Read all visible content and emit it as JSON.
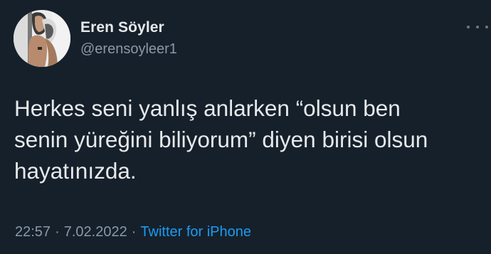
{
  "tweet": {
    "author": {
      "display_name": "Eren Söyler",
      "handle": "@erensoyleer1",
      "avatar": "profile-photo"
    },
    "more_icon": "more-horizontal-icon",
    "text": "Herkes seni yanlış anlarken “olsun ben\nsenin yüreğini biliyorum” diyen birisi olsun\nhayatınızda.",
    "time": "22:57",
    "date": "7.02.2022",
    "separator": "·",
    "source": "Twitter for iPhone"
  },
  "colors": {
    "background": "#15202b",
    "text_primary": "#e7e9ea",
    "text_secondary": "#8b98a5",
    "link": "#1d9bf0"
  }
}
